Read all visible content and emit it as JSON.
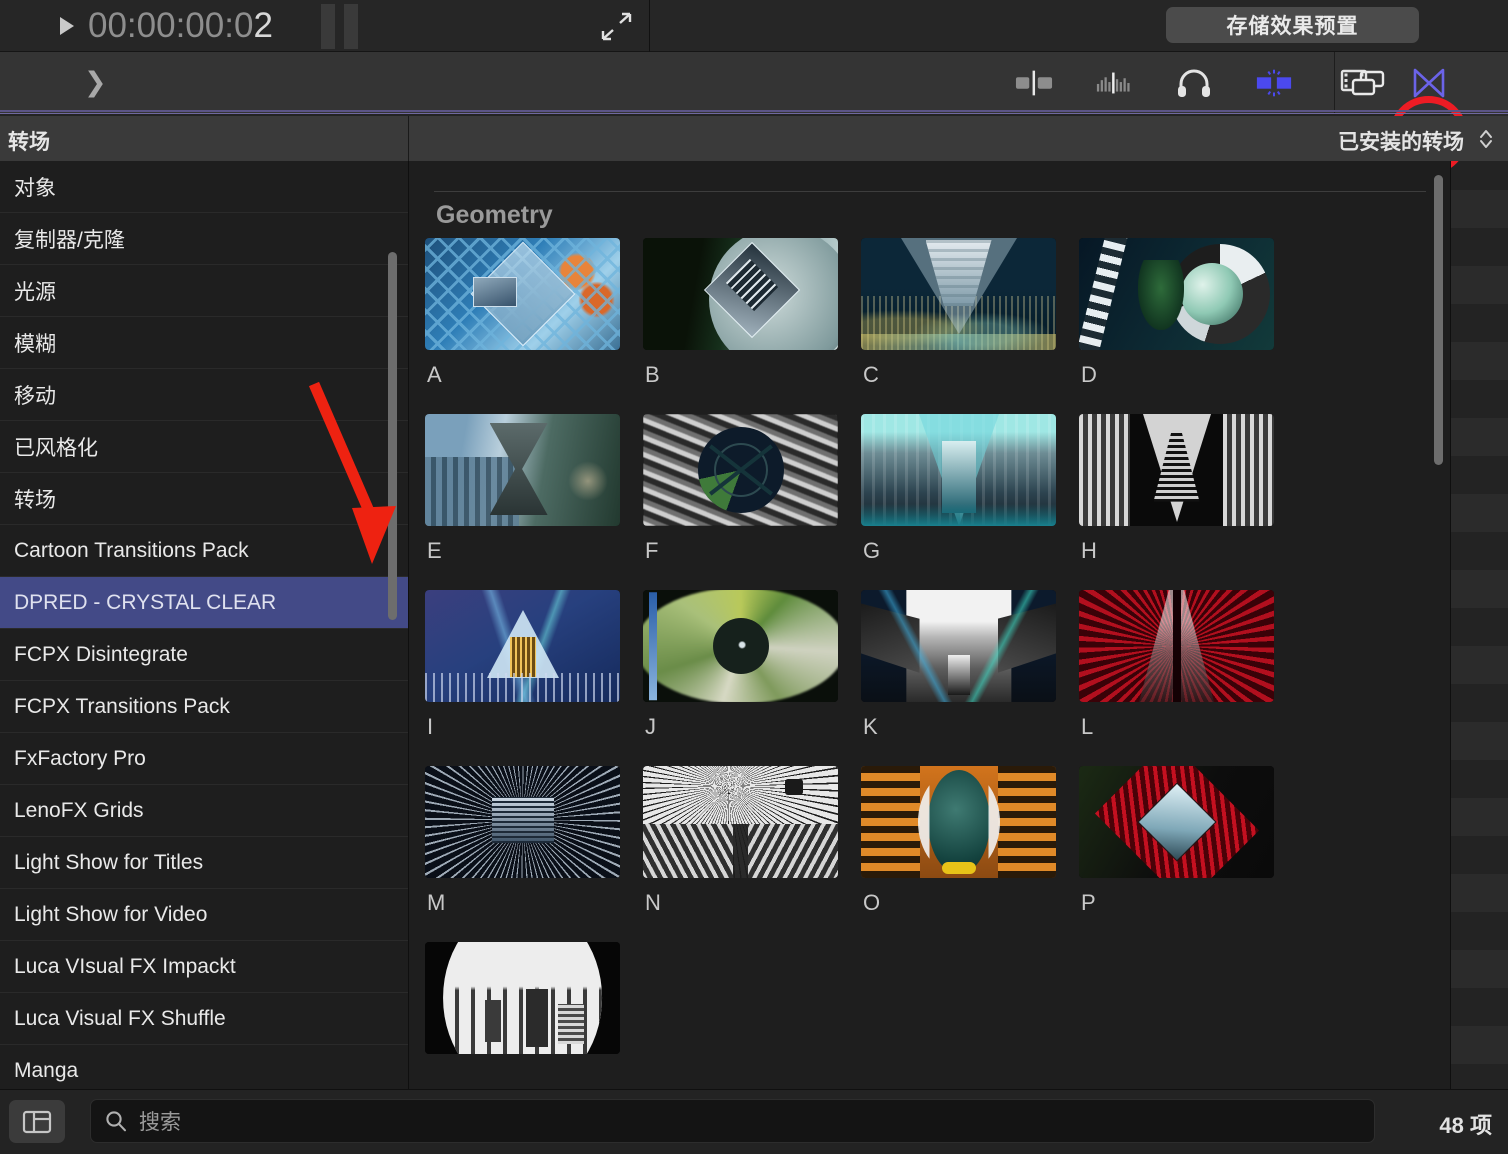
{
  "viewer": {
    "timecode": "00:00:00:0",
    "timecode_last": "2",
    "play_icon": "play-triangle-icon",
    "pause_icon": "pause-bars-icon",
    "expand_icon": "expand-fullscreen-icon"
  },
  "topbar": {
    "save_preset_label": "存储效果预置"
  },
  "toolbar": {
    "expand_chevron": "chevron-right-icon",
    "icons": [
      {
        "name": "transitions-browser-icon",
        "label": "转场浏览器"
      },
      {
        "name": "audio-meters-icon",
        "label": "音频指示器"
      },
      {
        "name": "headphones-icon",
        "label": "音频效果"
      },
      {
        "name": "effects-browser-icon",
        "label": "效果浏览器"
      },
      {
        "name": "titles-generators-icon",
        "label": "字幕和发生器"
      }
    ],
    "right_icons": [
      {
        "name": "window-layout-icon",
        "label": "窗口布局"
      },
      {
        "name": "transitions-bowtie-icon",
        "label": "转场"
      }
    ],
    "highlighted_icon": "transitions-bowtie-icon",
    "highlight_color": "#ed1c24",
    "accent_color": "#4b49ee"
  },
  "panels": {
    "sidebar_title": "转场",
    "installed_title": "已安装的转场",
    "sort_icon": "sort-chevron-icon"
  },
  "sidebar": {
    "items": [
      {
        "label": "对象",
        "selected": false
      },
      {
        "label": "复制器/克隆",
        "selected": false
      },
      {
        "label": "光源",
        "selected": false
      },
      {
        "label": "模糊",
        "selected": false
      },
      {
        "label": "移动",
        "selected": false
      },
      {
        "label": "已风格化",
        "selected": false
      },
      {
        "label": "转场",
        "selected": false
      },
      {
        "label": "Cartoon Transitions Pack",
        "selected": false
      },
      {
        "label": "DPRED - CRYSTAL CLEAR",
        "selected": true
      },
      {
        "label": "FCPX Disintegrate",
        "selected": false
      },
      {
        "label": "FCPX Transitions Pack",
        "selected": false
      },
      {
        "label": "FxFactory Pro",
        "selected": false
      },
      {
        "label": "LenoFX Grids",
        "selected": false
      },
      {
        "label": "Light Show for Titles",
        "selected": false
      },
      {
        "label": "Light Show for Video",
        "selected": false
      },
      {
        "label": "Luca VIsual FX Impackt",
        "selected": false
      },
      {
        "label": "Luca Visual FX Shuffle",
        "selected": false
      },
      {
        "label": "Manga",
        "selected": false
      }
    ],
    "selected_color": "#434a87"
  },
  "content": {
    "group_title": "Geometry",
    "rows": [
      [
        {
          "label": "A",
          "thumb": "chainlink-fence-diamond"
        },
        {
          "label": "B",
          "thumb": "aerial-road-diamond"
        },
        {
          "label": "C",
          "thumb": "city-night-triangle"
        },
        {
          "label": "D",
          "thumb": "nature-circle-ring"
        }
      ],
      [
        {
          "label": "E",
          "thumb": "cityscape-hourglass"
        },
        {
          "label": "F",
          "thumb": "crowd-circle-x"
        },
        {
          "label": "G",
          "thumb": "teal-tunnel-kaleidoscope"
        },
        {
          "label": "H",
          "thumb": "bw-tunnel-kaleidoscope"
        }
      ],
      [
        {
          "label": "I",
          "thumb": "blue-stage-triangle"
        },
        {
          "label": "J",
          "thumb": "green-lens-circle"
        },
        {
          "label": "K",
          "thumb": "bw-street-mirror"
        },
        {
          "label": "L",
          "thumb": "red-tunnel-mirror"
        }
      ],
      [
        {
          "label": "M",
          "thumb": "skyscraper-starburst"
        },
        {
          "label": "N",
          "thumb": "bw-bridge-cables"
        },
        {
          "label": "O",
          "thumb": "orange-globe-split"
        },
        {
          "label": "P",
          "thumb": "red-crystal-diamond"
        }
      ],
      [
        {
          "label": "",
          "thumb": "bw-city-circle"
        }
      ]
    ]
  },
  "bottombar": {
    "sidebar_toggle_icon": "sidebar-layout-icon",
    "search_icon": "search-icon",
    "search_placeholder": "搜索",
    "search_value": "",
    "item_count": "48 项"
  },
  "annotation": {
    "arrow_color": "#ee2211",
    "arrow_points_to": "DPRED - CRYSTAL CLEAR"
  }
}
